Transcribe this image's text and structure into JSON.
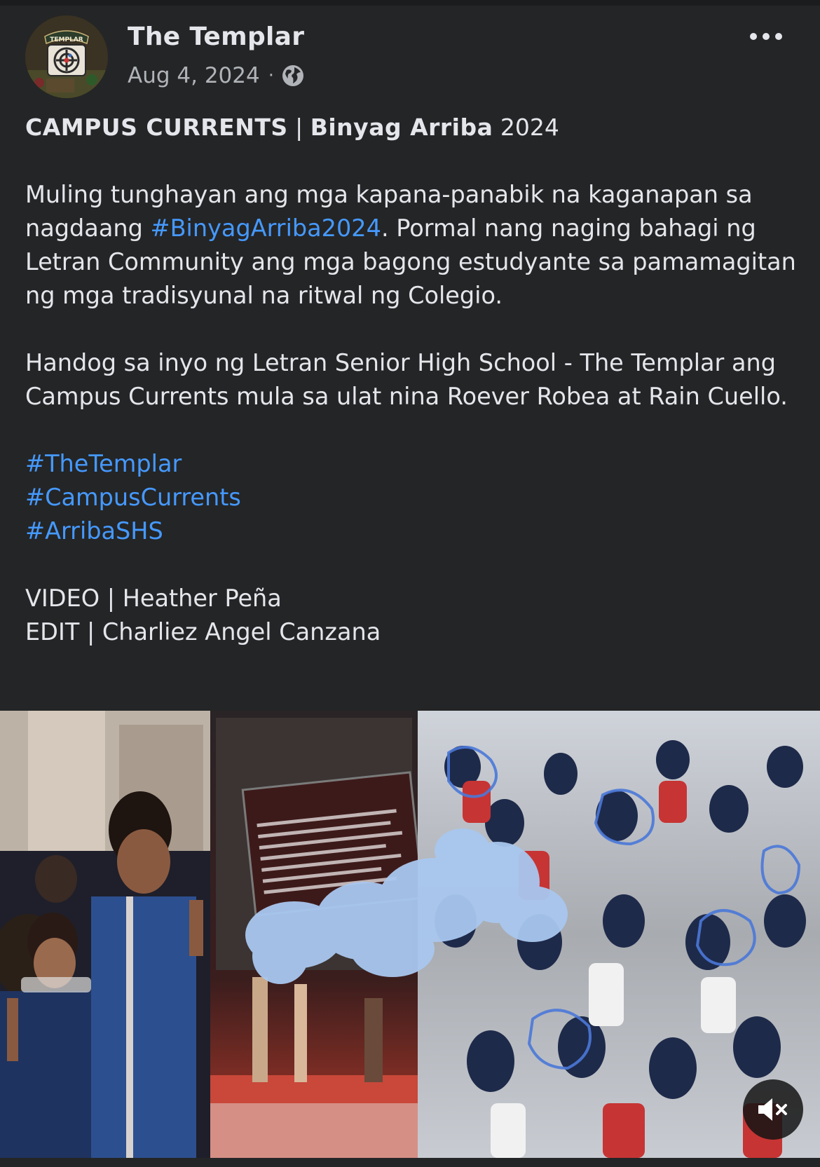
{
  "post": {
    "page_name": "The Templar",
    "date": "Aug 4, 2024",
    "separator": "·",
    "privacy_icon": "globe-icon",
    "avatar_badge_text": "TEMPLAR",
    "title_bold_1": "CAMPUS CURRENTS",
    "title_sep": " | ",
    "title_bold_2": "Binyag Arriba",
    "title_year": " 2024",
    "para1_a": "Muling tunghayan ang mga kapana-panabik na kaganapan sa nagdaang ",
    "para1_hashtag": "#BinyagArriba2024",
    "para1_b": ". Pormal nang naging bahagi ng Letran Community ang mga bagong estudyante sa pamamagitan ng mga tradisyunal na ritwal ng Colegio.",
    "para2": "Handog sa inyo ng Letran Senior High School - The Templar ang Campus Currents mula sa ulat nina Roever Robea at Rain Cuello.",
    "hashtags": [
      "#TheTemplar",
      "#CampusCurrents",
      "#ArribaSHS"
    ],
    "credit_video": "VIDEO | Heather Peña",
    "credit_edit": "EDIT | Charliez Angel Canzana"
  },
  "video": {
    "mute_icon": "speaker-muted-icon"
  },
  "colors": {
    "background": "#242526",
    "text": "#e4e6eb",
    "secondary_text": "#b0b3b8",
    "hashtag": "#4599ff"
  }
}
